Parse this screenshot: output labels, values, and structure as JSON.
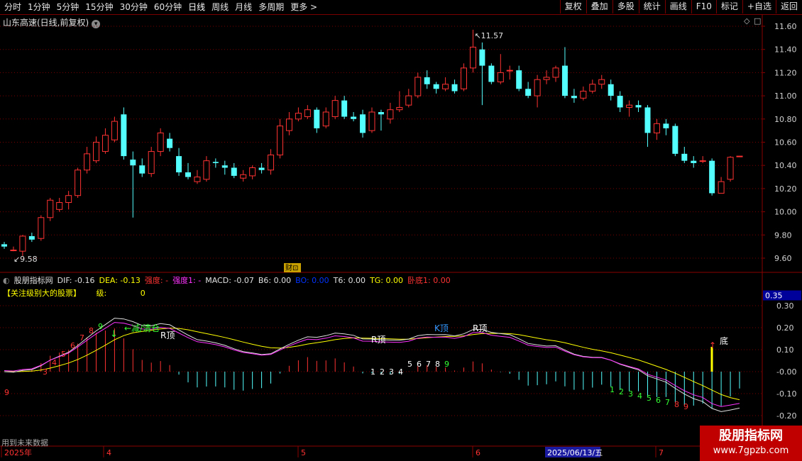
{
  "toolbar": {
    "periods": [
      "分时",
      "1分钟",
      "5分钟",
      "15分钟",
      "30分钟",
      "60分钟",
      "日线",
      "周线",
      "月线",
      "多周期",
      "更多 >"
    ],
    "active_period": "日线",
    "right_buttons": [
      "复权",
      "叠加",
      "多股",
      "统计",
      "画线",
      "F10",
      "标记",
      "+自选",
      "返回"
    ]
  },
  "main_chart": {
    "title": "山东高速(日线,前复权)",
    "high_label": "11.57",
    "low_label": "9.58",
    "finance_badge": "财",
    "y_ticks": [
      "11.60",
      "11.40",
      "11.20",
      "11.00",
      "10.80",
      "10.60",
      "10.40",
      "10.20",
      "10.00",
      "9.80",
      "9.60"
    ]
  },
  "indicator": {
    "name": "股朋指标网",
    "values": [
      {
        "label": "DIF:",
        "value": "-0.16",
        "color": "#e0e0e0"
      },
      {
        "label": "DEA:",
        "value": "-0.13",
        "color": "#ffff00"
      },
      {
        "label": "强度:",
        "value": "-",
        "color": "#ff3333"
      },
      {
        "label": "强度1:",
        "value": "-",
        "color": "#ff33ff"
      },
      {
        "label": "MACD:",
        "value": "-0.07",
        "color": "#e0e0e0"
      },
      {
        "label": "B6:",
        "value": "0.00",
        "color": "#e0e0e0"
      },
      {
        "label": "BO:",
        "value": "0.00",
        "color": "#0033ff"
      },
      {
        "label": "T6:",
        "value": "0.00",
        "color": "#e0e0e0"
      },
      {
        "label": "TG:",
        "value": "0.00",
        "color": "#ffff00"
      },
      {
        "label": "卧底1:",
        "value": "0.00",
        "color": "#ff3333"
      }
    ],
    "line2_label": "【关注级别大的股票】",
    "line2_key": "级:",
    "line2_value": "0",
    "y_ticks": [
      "0.35",
      "0.30",
      "0.20",
      "0.10",
      "-0.00",
      "-0.10",
      "-0.20"
    ],
    "annotations": {
      "reduce": "减/清仓",
      "r1": "R顶",
      "r2": "R顶",
      "k": "K顶",
      "r3": "R顶",
      "bottom": "底"
    },
    "count_top": [
      "3",
      "4",
      "5",
      "6",
      "7",
      "8",
      "9"
    ],
    "count_mid": [
      "1",
      "2",
      "3",
      "4",
      "5",
      "6",
      "7",
      "8",
      "9"
    ],
    "count_low": [
      "1",
      "2",
      "3",
      "4",
      "5",
      "6",
      "7",
      "8",
      "9"
    ]
  },
  "footer": {
    "note": "用到未来数据",
    "dates": [
      "2025年",
      "4",
      "5",
      "6",
      "7"
    ],
    "cursor_date": "2025/06/13/五"
  },
  "watermark": {
    "title": "股朋指标网",
    "url": "www.7gpzb.com"
  }
}
